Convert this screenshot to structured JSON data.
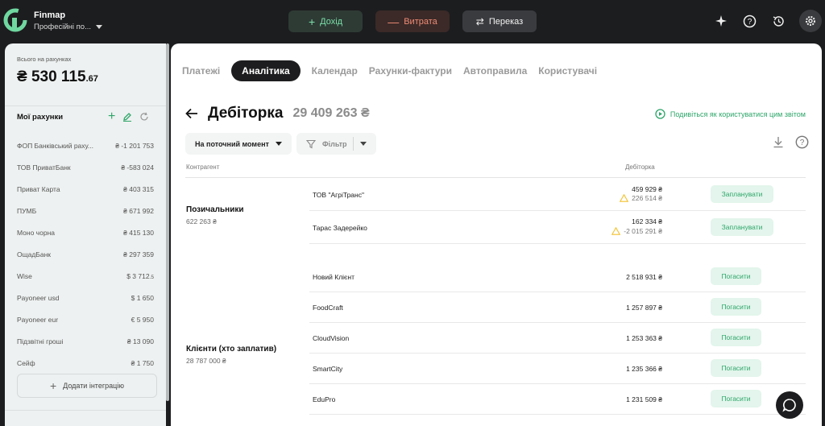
{
  "app": {
    "name": "Finmap",
    "workspace": "Професійні по..."
  },
  "topbar": {
    "income_label": "Дохід",
    "expense_label": "Витрата",
    "transfer_label": "Переказ"
  },
  "sidebar": {
    "total_caption": "Всього на рахунках",
    "total_main": "₴ 530 115",
    "total_cents": ".67",
    "accounts_title": "Мої рахунки",
    "accounts": [
      {
        "name": "ФОП Банківський раху...",
        "amount": "₴ -1 201 753"
      },
      {
        "name": "ТОВ ПриватБанк",
        "amount": "₴ -583 024"
      },
      {
        "name": "Приват Карта",
        "amount": "₴ 403 315"
      },
      {
        "name": "ПУМБ",
        "amount": "₴ 671 992"
      },
      {
        "name": "Моно чорна",
        "amount": "₴ 415 130"
      },
      {
        "name": "ОщадБанк",
        "amount": "₴ 297 359"
      },
      {
        "name": "Wise",
        "amount": "$ 3 712",
        "cents": ".5"
      },
      {
        "name": "Payoneer usd",
        "amount": "$ 1 650"
      },
      {
        "name": "Payoneer eur",
        "amount": "€ 5 950"
      },
      {
        "name": "Підзвітні гроші",
        "amount": "₴ 13 090"
      },
      {
        "name": "Сейф",
        "amount": "₴ 1 750"
      }
    ],
    "add_integration_label": "Додати інтеграцію"
  },
  "tabs": [
    {
      "label": "Платежі",
      "active": false
    },
    {
      "label": "Аналітика",
      "active": true
    },
    {
      "label": "Календар",
      "active": false
    },
    {
      "label": "Рахунки-фактури",
      "active": false
    },
    {
      "label": "Автоправила",
      "active": false
    },
    {
      "label": "Користувачі",
      "active": false
    }
  ],
  "report": {
    "title": "Дебіторка",
    "total": "29 409 263 ₴",
    "help_link": "Подивіться як користуватися цим звітом",
    "period_dropdown": "На поточний момент",
    "filter_label": "Фільтр",
    "col_counterparty": "Контрагент",
    "col_receivable": "Дебіторка"
  },
  "groups": [
    {
      "name": "Позичальники",
      "sum": "622 263 ₴",
      "rows": [
        {
          "name": "ТОВ \"АгріТранс\"",
          "amount": "459 929 ₴",
          "warning": "226 514 ₴",
          "action": "Запланувати"
        },
        {
          "name": "Тарас Задерейко",
          "amount": "162 334 ₴",
          "warning": "-2 015 291 ₴",
          "action": "Запланувати"
        }
      ]
    },
    {
      "name": "Клієнти (хто заплатив)",
      "sum": "28 787 000 ₴",
      "rows": [
        {
          "name": "Новий Клієнт",
          "amount": "2 518 931 ₴",
          "action": "Погасити"
        },
        {
          "name": "FoodCraft",
          "amount": "1 257 897 ₴",
          "action": "Погасити"
        },
        {
          "name": "CloudVision",
          "amount": "1 253 363 ₴",
          "action": "Погасити"
        },
        {
          "name": "SmartCity",
          "amount": "1 235 366 ₴",
          "action": "Погасити"
        },
        {
          "name": "EduPro",
          "amount": "1 231 509 ₴",
          "action": "Погасити"
        }
      ]
    }
  ],
  "colors": {
    "accent_green": "#2ea66a",
    "income_text": "#7be0a9",
    "expense_text": "#f08b74",
    "warning_yellow": "#f2c230"
  }
}
